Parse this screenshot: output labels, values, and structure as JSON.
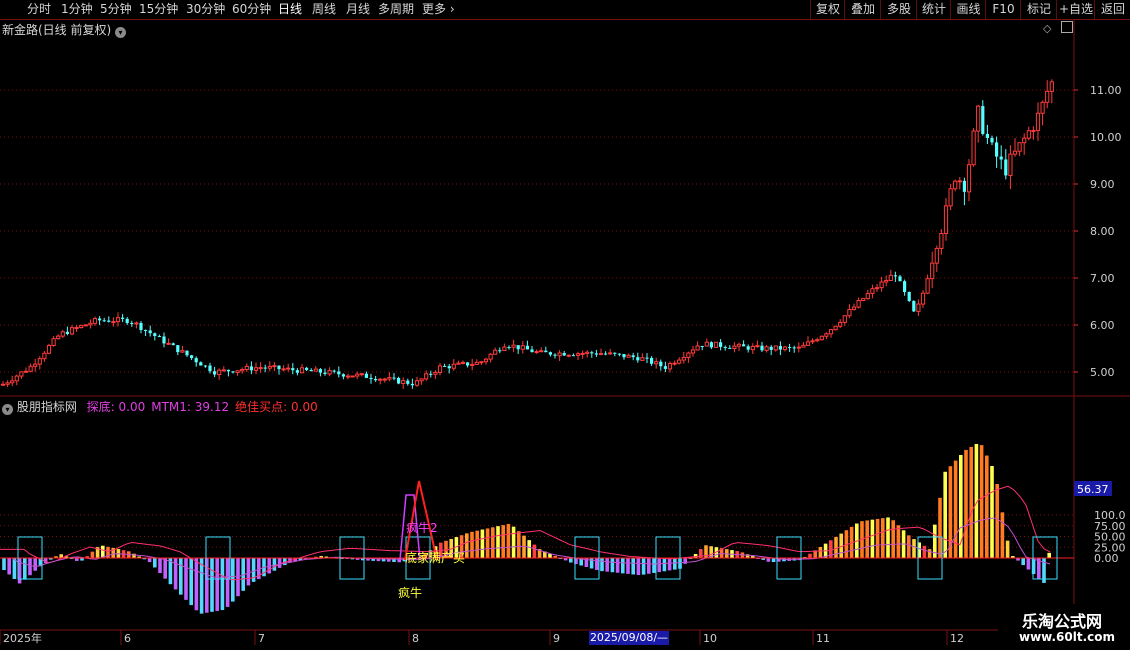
{
  "toolbar": {
    "periods": [
      "分时",
      "1分钟",
      "5分钟",
      "15分钟",
      "30分钟",
      "60分钟",
      "日线",
      "周线",
      "月线",
      "多周期",
      "更多"
    ],
    "active": "日线",
    "right_buttons": [
      "复权",
      "叠加",
      "多股",
      "统计",
      "画线",
      "F10",
      "标记",
      "+自选",
      "返回"
    ]
  },
  "main_chart": {
    "title": "新金路(日线 前复权)",
    "y_ticks": [
      "11.00",
      "10.00",
      "9.00",
      "8.00",
      "7.00",
      "6.00",
      "5.00"
    ]
  },
  "indicator": {
    "name": "股朋指标网",
    "line_values": [
      {
        "label": "探底:",
        "value": "0.00",
        "color": "#e040e0"
      },
      {
        "label": "MTM1:",
        "value": "39.12",
        "color": "#e040e0"
      },
      {
        "label": "绝佳买点:",
        "value": "0.00",
        "color": "#ff3030"
      }
    ],
    "y_ticks": [
      "100.0",
      "75.00",
      "50.00",
      "25.00",
      "0.00"
    ],
    "value_box": "56.37",
    "annotations": [
      "疯牛2",
      "底家满产买",
      "疯牛"
    ]
  },
  "x_axis": {
    "labels": [
      "2025年",
      "6",
      "7",
      "8",
      "9",
      "10",
      "11",
      "12"
    ],
    "cursor_date": "2025/09/08/—"
  },
  "watermark": {
    "line1": "乐淘公式网",
    "line2": "www.60lt.com"
  },
  "colors": {
    "up": "#ff3b3b",
    "down": "#54ffff",
    "grid": "#7a1010",
    "bg": "#000000"
  },
  "chart_data": {
    "type": "candlestick",
    "x_range": [
      "2025-05",
      "2025-12"
    ],
    "ylim": [
      4.4,
      11.7
    ],
    "ohlc_count": 230,
    "last_close": 11.15,
    "indicator_ylim": [
      -150,
      160
    ]
  }
}
